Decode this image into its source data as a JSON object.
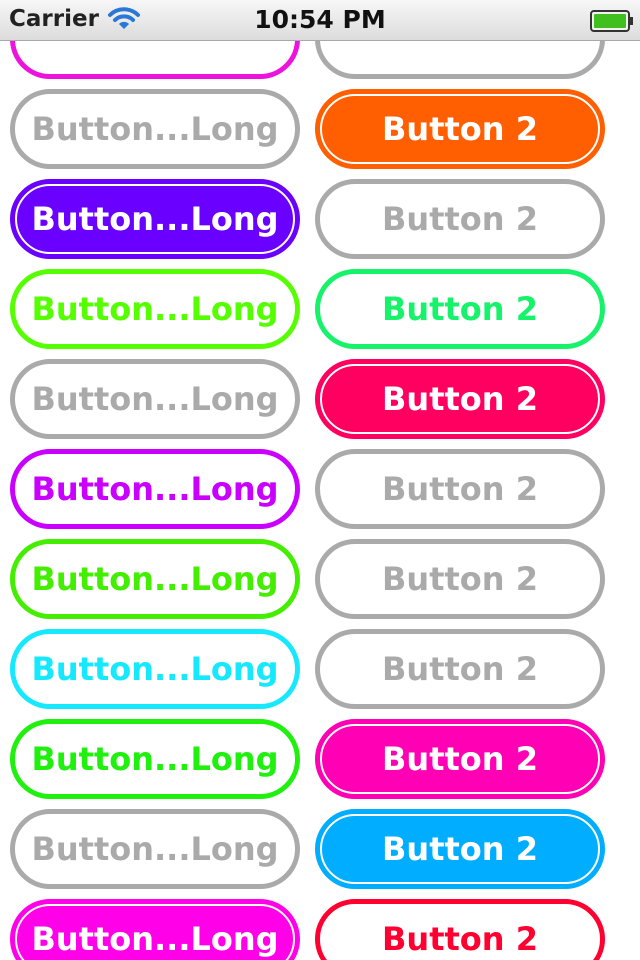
{
  "status_bar": {
    "carrier": "Carrier",
    "time": "10:54 PM"
  },
  "rows": [
    {
      "left": {
        "label": "",
        "style": "outline",
        "color": "#ee12dd"
      },
      "right": {
        "label": "",
        "style": "outline",
        "color": "#aaaaaa"
      }
    },
    {
      "left": {
        "label": "Button...Long",
        "style": "outline",
        "color": "#aaaaaa"
      },
      "right": {
        "label": "Button 2",
        "style": "filled",
        "color": "#ff5f00"
      }
    },
    {
      "left": {
        "label": "Button...Long",
        "style": "filled",
        "color": "#6a00ff"
      },
      "right": {
        "label": "Button 2",
        "style": "outline",
        "color": "#aaaaaa"
      }
    },
    {
      "left": {
        "label": "Button...Long",
        "style": "outline",
        "color": "#55ff00"
      },
      "right": {
        "label": "Button 2",
        "style": "outline",
        "color": "#16f26a"
      }
    },
    {
      "left": {
        "label": "Button...Long",
        "style": "outline",
        "color": "#aaaaaa"
      },
      "right": {
        "label": "Button 2",
        "style": "filled",
        "color": "#ff0060"
      }
    },
    {
      "left": {
        "label": "Button...Long",
        "style": "outline",
        "color": "#c900ff"
      },
      "right": {
        "label": "Button 2",
        "style": "outline",
        "color": "#aaaaaa"
      }
    },
    {
      "left": {
        "label": "Button...Long",
        "style": "outline",
        "color": "#44ee00"
      },
      "right": {
        "label": "Button 2",
        "style": "outline",
        "color": "#aaaaaa"
      }
    },
    {
      "left": {
        "label": "Button...Long",
        "style": "outline",
        "color": "#16e8ff"
      },
      "right": {
        "label": "Button 2",
        "style": "outline",
        "color": "#aaaaaa"
      }
    },
    {
      "left": {
        "label": "Button...Long",
        "style": "outline",
        "color": "#1ff00e"
      },
      "right": {
        "label": "Button 2",
        "style": "filled",
        "color": "#ff00b4"
      }
    },
    {
      "left": {
        "label": "Button...Long",
        "style": "outline",
        "color": "#aaaaaa"
      },
      "right": {
        "label": "Button 2",
        "style": "filled",
        "color": "#00adff"
      }
    },
    {
      "left": {
        "label": "Button...Long",
        "style": "filled",
        "color": "#ff00e8"
      },
      "right": {
        "label": "Button 2",
        "style": "outline",
        "color": "#ff0030"
      }
    }
  ]
}
